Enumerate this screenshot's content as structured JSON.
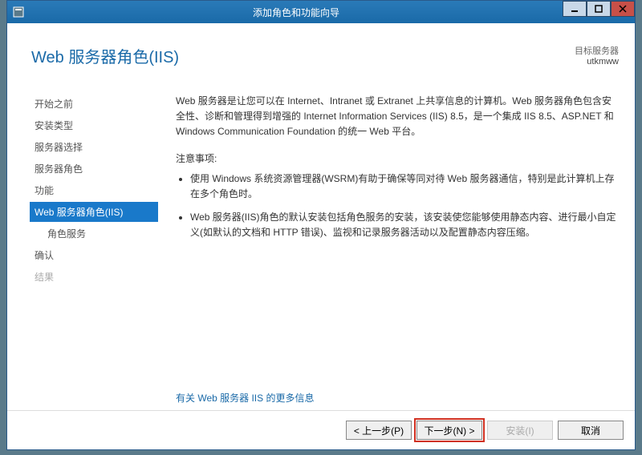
{
  "window": {
    "title": "添加角色和功能向导"
  },
  "header": {
    "page_title": "Web 服务器角色(IIS)",
    "target_label": "目标服务器",
    "target_name": "utkmww"
  },
  "sidebar": {
    "items": [
      {
        "label": "开始之前",
        "state": "link"
      },
      {
        "label": "安装类型",
        "state": "link"
      },
      {
        "label": "服务器选择",
        "state": "link"
      },
      {
        "label": "服务器角色",
        "state": "link"
      },
      {
        "label": "功能",
        "state": "link"
      },
      {
        "label": "Web 服务器角色(IIS)",
        "state": "selected"
      },
      {
        "label": "角色服务",
        "state": "sub"
      },
      {
        "label": "确认",
        "state": "link"
      },
      {
        "label": "结果",
        "state": "disabled"
      }
    ]
  },
  "content": {
    "intro": "Web 服务器是让您可以在 Internet、Intranet 或 Extranet 上共享信息的计算机。Web 服务器角色包含安全性、诊断和管理得到增强的 Internet Information Services (IIS) 8.5，是一个集成 IIS 8.5、ASP.NET 和 Windows Communication Foundation 的统一 Web 平台。",
    "notes_title": "注意事项:",
    "bullets": [
      "使用 Windows 系统资源管理器(WSRM)有助于确保等同对待 Web 服务器通信，特别是此计算机上存在多个角色时。",
      "Web 服务器(IIS)角色的默认安装包括角色服务的安装，该安装使您能够使用静态内容、进行最小自定义(如默认的文档和 HTTP 错误)、监视和记录服务器活动以及配置静态内容压缩。"
    ],
    "more_link": "有关 Web 服务器 IIS 的更多信息"
  },
  "footer": {
    "prev": "< 上一步(P)",
    "next": "下一步(N) >",
    "install": "安装(I)",
    "cancel": "取消"
  }
}
